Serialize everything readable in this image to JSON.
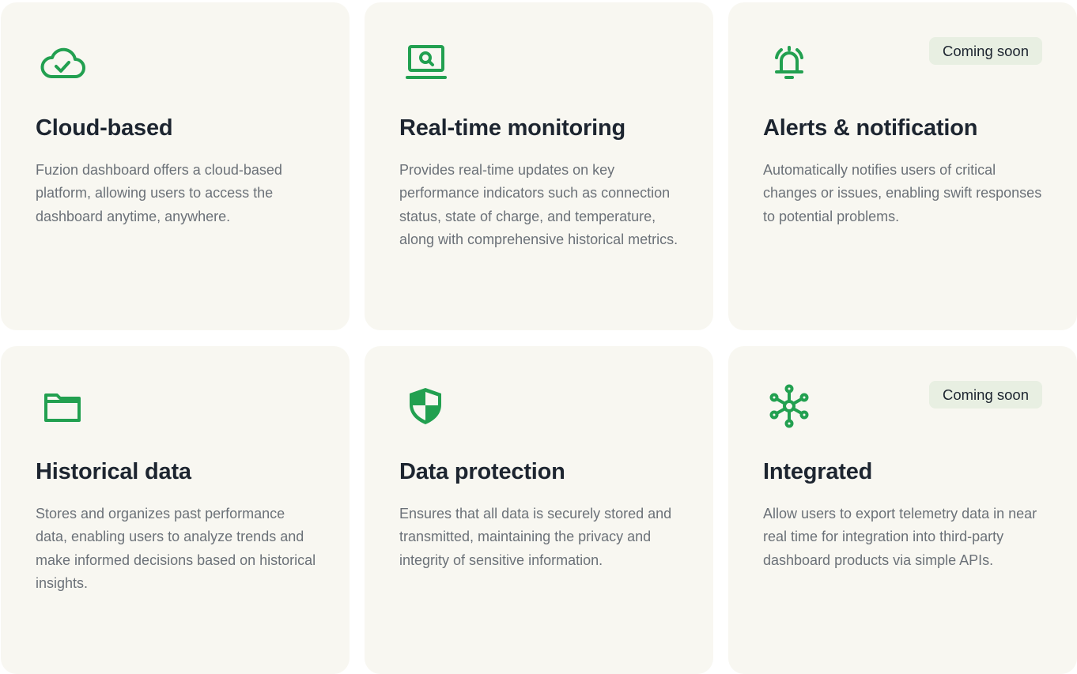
{
  "colors": {
    "card_background": "#f8f7f1",
    "icon_green": "#22a050",
    "title": "#1d2530",
    "description": "#6b7178",
    "badge_background": "#e8efe2"
  },
  "features": [
    {
      "icon": "cloud-check-icon",
      "title": "Cloud-based",
      "description": "Fuzion dashboard offers a cloud-based platform, allowing users to access the dashboard anytime, anywhere.",
      "badge": ""
    },
    {
      "icon": "laptop-search-icon",
      "title": "Real-time monitoring",
      "description": "Provides real-time updates on key performance indicators such as connection status, state of charge, and temperature, along with comprehensive historical metrics.",
      "badge": ""
    },
    {
      "icon": "bell-ringing-icon",
      "title": "Alerts & notification",
      "description": "Automatically notifies users of critical changes or issues, enabling swift responses to potential problems.",
      "badge": "Coming soon"
    },
    {
      "icon": "folder-icon",
      "title": "Historical data",
      "description": "Stores and organizes past performance data, enabling users to analyze trends and make informed decisions based on historical insights.",
      "badge": ""
    },
    {
      "icon": "shield-icon",
      "title": "Data protection",
      "description": "Ensures that all data is securely stored and transmitted, maintaining the privacy and integrity of sensitive information.",
      "badge": ""
    },
    {
      "icon": "network-hub-icon",
      "title": "Integrated",
      "description": "Allow users to export telemetry data in near real time for integration into third-party dashboard products via simple APIs.",
      "badge": "Coming soon"
    }
  ]
}
